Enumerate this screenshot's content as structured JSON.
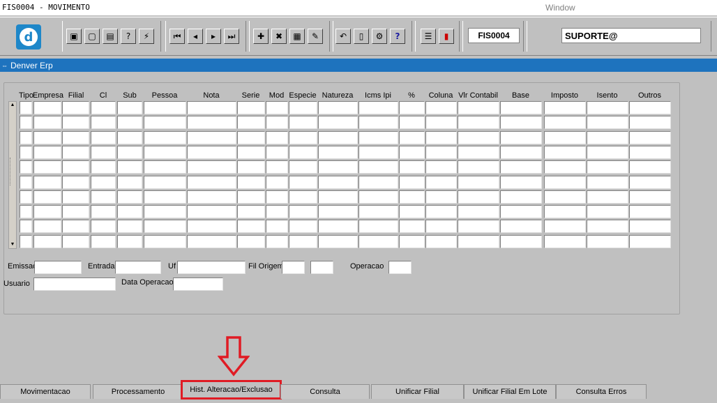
{
  "titlebar": {
    "title": "FIS0004 - MOVIMENTO",
    "window_menu": "Window"
  },
  "toolbar": {
    "form_code": "FIS0004",
    "user": "SUPORTE@"
  },
  "window": {
    "title": "Denver Erp"
  },
  "grid": {
    "columns": [
      "Tipo",
      "Empresa",
      "Filial",
      "Cl",
      "Sub",
      "Pessoa",
      "Nota",
      "Serie",
      "Mod",
      "Especie",
      "Natureza",
      "Icms Ipi",
      "%",
      "Coluna",
      "Vlr Contabil",
      "Base",
      "Imposto",
      "Isento",
      "Outros"
    ]
  },
  "fields": {
    "emissao": "Emissao",
    "entrada": "Entrada",
    "uf": "Uf",
    "fil_origem": "Fil Origem",
    "operacao": "Operacao",
    "usuario": "Usuario",
    "data_operacao": "Data Operacao"
  },
  "tabs": [
    "Movimentacao",
    "Processamento",
    "Hist. Alteracao/Exclusao",
    "Consulta",
    "Unificar Filial",
    "Unificar Filial Em Lote",
    "Consulta Erros"
  ],
  "colors": {
    "accent": "#1e73be",
    "highlight": "#e01b24"
  }
}
